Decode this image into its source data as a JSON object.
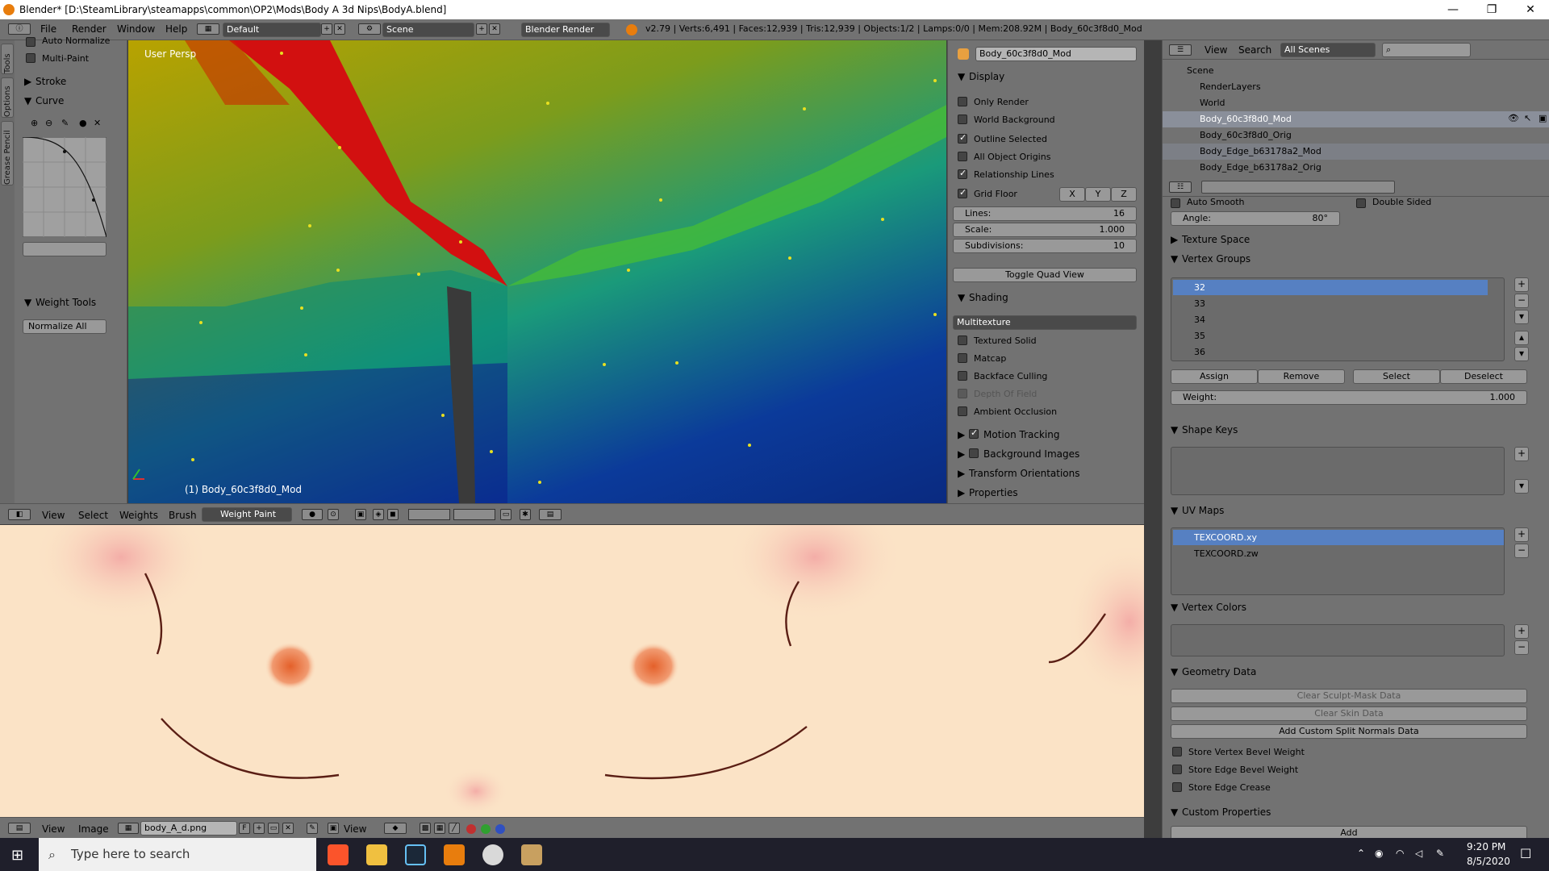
{
  "window": {
    "title": "Blender* [D:\\SteamLibrary\\steamapps\\common\\OP2\\Mods\\Body A 3d Nips\\BodyA.blend]",
    "min": "—",
    "max": "❐",
    "close": "✕"
  },
  "menu": {
    "file": "File",
    "render": "Render",
    "window": "Window",
    "help": "Help"
  },
  "layout": "Default",
  "scene": "Scene",
  "engine": "Blender Render",
  "stats": "v2.79 | Verts:6,491 | Faces:12,939 | Tris:12,939 | Objects:1/2 | Lamps:0/0 | Mem:208.92M | Body_60c3f8d0_Mod",
  "tools": {
    "vtabs": [
      "Tools",
      "Options",
      "Grease Pencil"
    ],
    "auto_normalize": "Auto Normalize",
    "multi_paint": "Multi-Paint",
    "stroke": "Stroke",
    "curve": "Curve",
    "weight_tools": "Weight Tools",
    "normalize_all": "Normalize All"
  },
  "viewport": {
    "persp": "User Persp",
    "object": "(1) Body_60c3f8d0_Mod"
  },
  "npanel": {
    "object_name": "Body_60c3f8d0_Mod",
    "display": "Display",
    "only_render": "Only Render",
    "world_background": "World Background",
    "outline_selected": "Outline Selected",
    "all_object_origins": "All Object Origins",
    "relationship_lines": "Relationship Lines",
    "grid_floor": "Grid Floor",
    "x": "X",
    "y": "Y",
    "z": "Z",
    "lines_label": "Lines:",
    "lines_value": "16",
    "scale_label": "Scale:",
    "scale_value": "1.000",
    "subdiv_label": "Subdivisions:",
    "subdiv_value": "10",
    "toggle_quad": "Toggle Quad View",
    "shading": "Shading",
    "multitexture": "Multitexture",
    "textured_solid": "Textured Solid",
    "matcap": "Matcap",
    "backface_culling": "Backface Culling",
    "depth_of_field": "Depth Of Field",
    "ambient_occlusion": "Ambient Occlusion",
    "motion_tracking": "Motion Tracking",
    "background_images": "Background Images",
    "transform_orientations": "Transform Orientations",
    "properties": "Properties"
  },
  "vheader": {
    "view": "View",
    "select": "Select",
    "weights": "Weights",
    "brush": "Brush",
    "mode": "Weight Paint"
  },
  "iheader": {
    "view": "View",
    "image": "Image",
    "image_name": "body_A_d.png",
    "f": "F",
    "view2": "View"
  },
  "outliner": {
    "view": "View",
    "search": "Search",
    "filter": "All Scenes",
    "rows": [
      "Scene",
      "RenderLayers",
      "World",
      "Body_60c3f8d0_Mod",
      "Body_60c3f8d0_Orig",
      "Body_Edge_b63178a2_Mod",
      "Body_Edge_b63178a2_Orig"
    ]
  },
  "props": {
    "auto_smooth": "Auto Smooth",
    "double_sided": "Double Sided",
    "angle_label": "Angle:",
    "angle_value": "80°",
    "texture_space": "Texture Space",
    "vertex_groups": "Vertex Groups",
    "groups": [
      "32",
      "33",
      "34",
      "35",
      "36"
    ],
    "assign": "Assign",
    "remove": "Remove",
    "select": "Select",
    "deselect": "Deselect",
    "weight_label": "Weight:",
    "weight_value": "1.000",
    "shape_keys": "Shape Keys",
    "uv_maps": "UV Maps",
    "uvs": [
      "TEXCOORD.xy",
      "TEXCOORD.zw"
    ],
    "vertex_colors": "Vertex Colors",
    "geometry_data": "Geometry Data",
    "clear_sculpt": "Clear Sculpt-Mask Data",
    "clear_skin": "Clear Skin Data",
    "add_split": "Add Custom Split Normals Data",
    "store_vbw": "Store Vertex Bevel Weight",
    "store_ebw": "Store Edge Bevel Weight",
    "store_ec": "Store Edge Crease",
    "custom_props": "Custom Properties",
    "add": "Add"
  },
  "taskbar": {
    "search": "Type here to search",
    "time": "9:20 PM",
    "date": "8/5/2020"
  }
}
